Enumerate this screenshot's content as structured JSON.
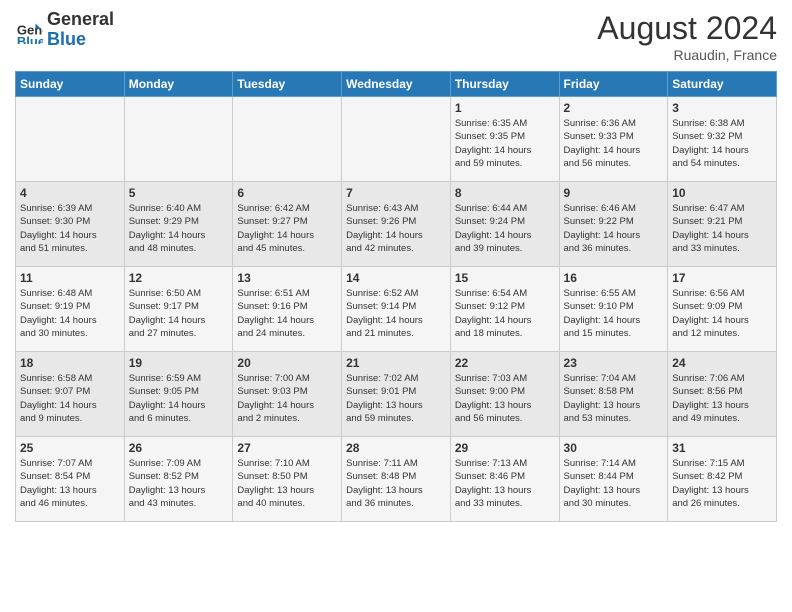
{
  "header": {
    "logo_line1": "General",
    "logo_line2": "Blue",
    "month_year": "August 2024",
    "location": "Ruaudin, France"
  },
  "weekdays": [
    "Sunday",
    "Monday",
    "Tuesday",
    "Wednesday",
    "Thursday",
    "Friday",
    "Saturday"
  ],
  "weeks": [
    [
      {
        "day": "",
        "info": ""
      },
      {
        "day": "",
        "info": ""
      },
      {
        "day": "",
        "info": ""
      },
      {
        "day": "",
        "info": ""
      },
      {
        "day": "1",
        "info": "Sunrise: 6:35 AM\nSunset: 9:35 PM\nDaylight: 14 hours\nand 59 minutes."
      },
      {
        "day": "2",
        "info": "Sunrise: 6:36 AM\nSunset: 9:33 PM\nDaylight: 14 hours\nand 56 minutes."
      },
      {
        "day": "3",
        "info": "Sunrise: 6:38 AM\nSunset: 9:32 PM\nDaylight: 14 hours\nand 54 minutes."
      }
    ],
    [
      {
        "day": "4",
        "info": "Sunrise: 6:39 AM\nSunset: 9:30 PM\nDaylight: 14 hours\nand 51 minutes."
      },
      {
        "day": "5",
        "info": "Sunrise: 6:40 AM\nSunset: 9:29 PM\nDaylight: 14 hours\nand 48 minutes."
      },
      {
        "day": "6",
        "info": "Sunrise: 6:42 AM\nSunset: 9:27 PM\nDaylight: 14 hours\nand 45 minutes."
      },
      {
        "day": "7",
        "info": "Sunrise: 6:43 AM\nSunset: 9:26 PM\nDaylight: 14 hours\nand 42 minutes."
      },
      {
        "day": "8",
        "info": "Sunrise: 6:44 AM\nSunset: 9:24 PM\nDaylight: 14 hours\nand 39 minutes."
      },
      {
        "day": "9",
        "info": "Sunrise: 6:46 AM\nSunset: 9:22 PM\nDaylight: 14 hours\nand 36 minutes."
      },
      {
        "day": "10",
        "info": "Sunrise: 6:47 AM\nSunset: 9:21 PM\nDaylight: 14 hours\nand 33 minutes."
      }
    ],
    [
      {
        "day": "11",
        "info": "Sunrise: 6:48 AM\nSunset: 9:19 PM\nDaylight: 14 hours\nand 30 minutes."
      },
      {
        "day": "12",
        "info": "Sunrise: 6:50 AM\nSunset: 9:17 PM\nDaylight: 14 hours\nand 27 minutes."
      },
      {
        "day": "13",
        "info": "Sunrise: 6:51 AM\nSunset: 9:16 PM\nDaylight: 14 hours\nand 24 minutes."
      },
      {
        "day": "14",
        "info": "Sunrise: 6:52 AM\nSunset: 9:14 PM\nDaylight: 14 hours\nand 21 minutes."
      },
      {
        "day": "15",
        "info": "Sunrise: 6:54 AM\nSunset: 9:12 PM\nDaylight: 14 hours\nand 18 minutes."
      },
      {
        "day": "16",
        "info": "Sunrise: 6:55 AM\nSunset: 9:10 PM\nDaylight: 14 hours\nand 15 minutes."
      },
      {
        "day": "17",
        "info": "Sunrise: 6:56 AM\nSunset: 9:09 PM\nDaylight: 14 hours\nand 12 minutes."
      }
    ],
    [
      {
        "day": "18",
        "info": "Sunrise: 6:58 AM\nSunset: 9:07 PM\nDaylight: 14 hours\nand 9 minutes."
      },
      {
        "day": "19",
        "info": "Sunrise: 6:59 AM\nSunset: 9:05 PM\nDaylight: 14 hours\nand 6 minutes."
      },
      {
        "day": "20",
        "info": "Sunrise: 7:00 AM\nSunset: 9:03 PM\nDaylight: 14 hours\nand 2 minutes."
      },
      {
        "day": "21",
        "info": "Sunrise: 7:02 AM\nSunset: 9:01 PM\nDaylight: 13 hours\nand 59 minutes."
      },
      {
        "day": "22",
        "info": "Sunrise: 7:03 AM\nSunset: 9:00 PM\nDaylight: 13 hours\nand 56 minutes."
      },
      {
        "day": "23",
        "info": "Sunrise: 7:04 AM\nSunset: 8:58 PM\nDaylight: 13 hours\nand 53 minutes."
      },
      {
        "day": "24",
        "info": "Sunrise: 7:06 AM\nSunset: 8:56 PM\nDaylight: 13 hours\nand 49 minutes."
      }
    ],
    [
      {
        "day": "25",
        "info": "Sunrise: 7:07 AM\nSunset: 8:54 PM\nDaylight: 13 hours\nand 46 minutes."
      },
      {
        "day": "26",
        "info": "Sunrise: 7:09 AM\nSunset: 8:52 PM\nDaylight: 13 hours\nand 43 minutes."
      },
      {
        "day": "27",
        "info": "Sunrise: 7:10 AM\nSunset: 8:50 PM\nDaylight: 13 hours\nand 40 minutes."
      },
      {
        "day": "28",
        "info": "Sunrise: 7:11 AM\nSunset: 8:48 PM\nDaylight: 13 hours\nand 36 minutes."
      },
      {
        "day": "29",
        "info": "Sunrise: 7:13 AM\nSunset: 8:46 PM\nDaylight: 13 hours\nand 33 minutes."
      },
      {
        "day": "30",
        "info": "Sunrise: 7:14 AM\nSunset: 8:44 PM\nDaylight: 13 hours\nand 30 minutes."
      },
      {
        "day": "31",
        "info": "Sunrise: 7:15 AM\nSunset: 8:42 PM\nDaylight: 13 hours\nand 26 minutes."
      }
    ]
  ]
}
